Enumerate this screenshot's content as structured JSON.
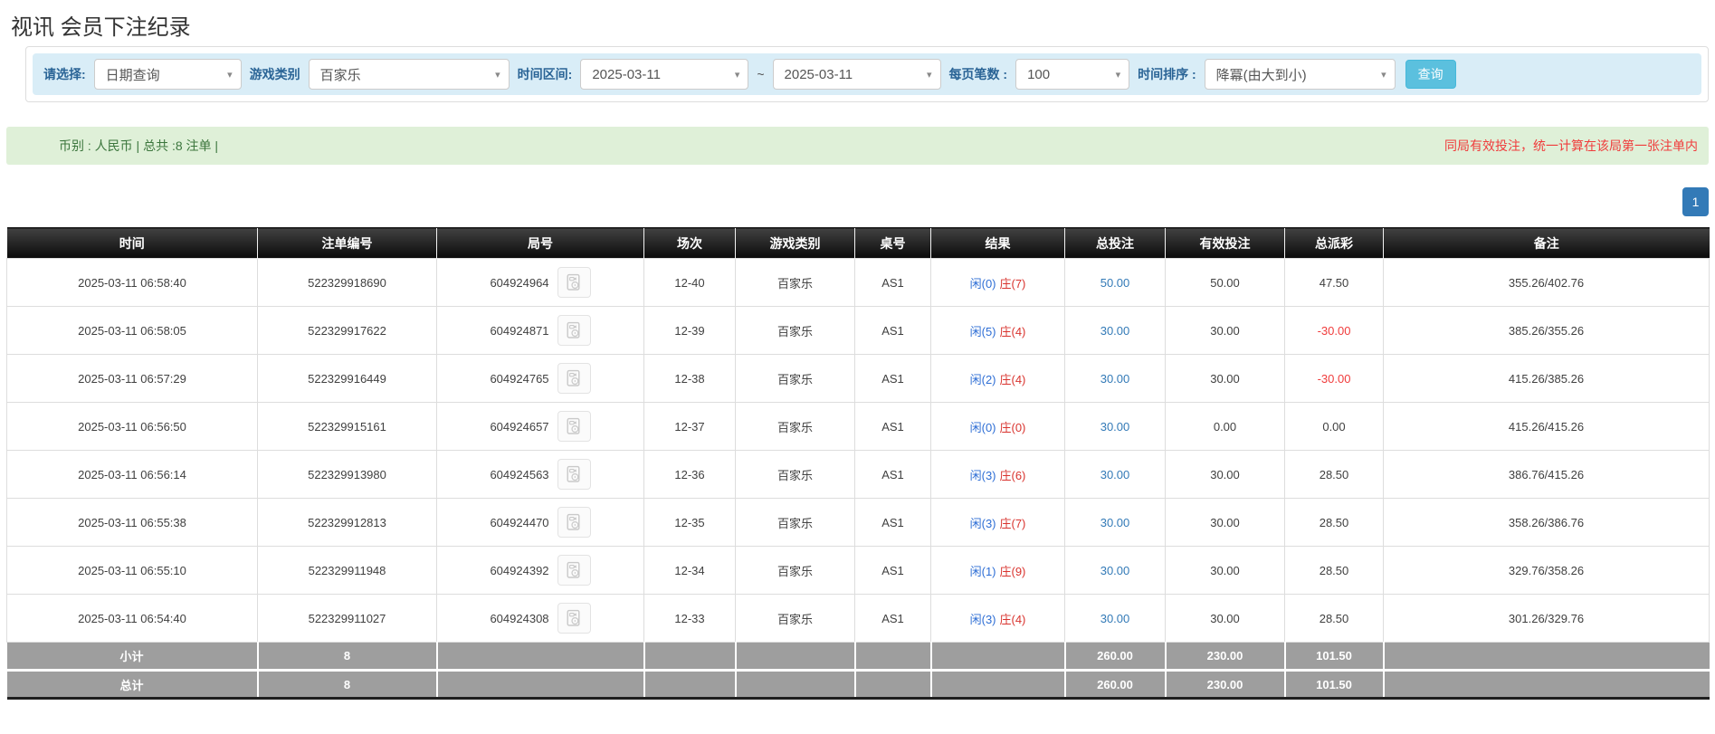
{
  "page": {
    "title": "视讯 会员下注纪录"
  },
  "filters": {
    "select_label": "请选择:",
    "select_value": "日期查询",
    "game_type_label": "游戏类别",
    "game_type_value": "百家乐",
    "time_range_label": "时间区间:",
    "date_from": "2025-03-11",
    "date_separator": "~",
    "date_to": "2025-03-11",
    "page_size_label": "每页笔数 :",
    "page_size_value": "100",
    "sort_label": "时间排序 :",
    "sort_value": "降冪(由大到小)",
    "search_button": "查询"
  },
  "summary": {
    "info": "币别 : 人民币 | 总共 :8 注单 |",
    "notice": "同局有效投注，统一计算在该局第一张注单内"
  },
  "pagination": {
    "current": "1"
  },
  "icons": {
    "caret_down_glyph": "▾"
  },
  "colors": {
    "accent_blue": "#337ab7",
    "search_button_blue": "#5bc0de",
    "player_blue": "#2e6ed5",
    "banker_red": "#d9342f",
    "negative_red": "#f03c3c",
    "notice_red": "#f03c3c",
    "header_bg": "#1c1c1c",
    "footer_bg": "#9e9e9e",
    "summary_bg": "#dff0d8",
    "filter_bg": "#d9edf7"
  },
  "table": {
    "headers": [
      "时间",
      "注单编号",
      "局号",
      "场次",
      "游戏类别",
      "桌号",
      "结果",
      "总投注",
      "有效投注",
      "总派彩",
      "备注"
    ],
    "rows": [
      {
        "time": "2025-03-11 06:58:40",
        "bet_id": "522329918690",
        "round_id": "604924964",
        "session": "12-40",
        "game": "百家乐",
        "table_no": "AS1",
        "result_player": "闲(0)",
        "result_banker": "庄(7)",
        "total_bet": "50.00",
        "valid_bet": "50.00",
        "payout": "47.50",
        "remark": "355.26/402.76"
      },
      {
        "time": "2025-03-11 06:58:05",
        "bet_id": "522329917622",
        "round_id": "604924871",
        "session": "12-39",
        "game": "百家乐",
        "table_no": "AS1",
        "result_player": "闲(5)",
        "result_banker": "庄(4)",
        "total_bet": "30.00",
        "valid_bet": "30.00",
        "payout": "-30.00",
        "remark": "385.26/355.26"
      },
      {
        "time": "2025-03-11 06:57:29",
        "bet_id": "522329916449",
        "round_id": "604924765",
        "session": "12-38",
        "game": "百家乐",
        "table_no": "AS1",
        "result_player": "闲(2)",
        "result_banker": "庄(4)",
        "total_bet": "30.00",
        "valid_bet": "30.00",
        "payout": "-30.00",
        "remark": "415.26/385.26"
      },
      {
        "time": "2025-03-11 06:56:50",
        "bet_id": "522329915161",
        "round_id": "604924657",
        "session": "12-37",
        "game": "百家乐",
        "table_no": "AS1",
        "result_player": "闲(0)",
        "result_banker": "庄(0)",
        "total_bet": "30.00",
        "valid_bet": "0.00",
        "payout": "0.00",
        "remark": "415.26/415.26"
      },
      {
        "time": "2025-03-11 06:56:14",
        "bet_id": "522329913980",
        "round_id": "604924563",
        "session": "12-36",
        "game": "百家乐",
        "table_no": "AS1",
        "result_player": "闲(3)",
        "result_banker": "庄(6)",
        "total_bet": "30.00",
        "valid_bet": "30.00",
        "payout": "28.50",
        "remark": "386.76/415.26"
      },
      {
        "time": "2025-03-11 06:55:38",
        "bet_id": "522329912813",
        "round_id": "604924470",
        "session": "12-35",
        "game": "百家乐",
        "table_no": "AS1",
        "result_player": "闲(3)",
        "result_banker": "庄(7)",
        "total_bet": "30.00",
        "valid_bet": "30.00",
        "payout": "28.50",
        "remark": "358.26/386.76"
      },
      {
        "time": "2025-03-11 06:55:10",
        "bet_id": "522329911948",
        "round_id": "604924392",
        "session": "12-34",
        "game": "百家乐",
        "table_no": "AS1",
        "result_player": "闲(1)",
        "result_banker": "庄(9)",
        "total_bet": "30.00",
        "valid_bet": "30.00",
        "payout": "28.50",
        "remark": "329.76/358.26"
      },
      {
        "time": "2025-03-11 06:54:40",
        "bet_id": "522329911027",
        "round_id": "604924308",
        "session": "12-33",
        "game": "百家乐",
        "table_no": "AS1",
        "result_player": "闲(3)",
        "result_banker": "庄(4)",
        "total_bet": "30.00",
        "valid_bet": "30.00",
        "payout": "28.50",
        "remark": "301.26/329.76"
      }
    ],
    "subtotal": {
      "label": "小计",
      "count": "8",
      "total_bet": "260.00",
      "valid_bet": "230.00",
      "payout": "101.50"
    },
    "total": {
      "label": "总计",
      "count": "8",
      "total_bet": "260.00",
      "valid_bet": "230.00",
      "payout": "101.50"
    }
  }
}
